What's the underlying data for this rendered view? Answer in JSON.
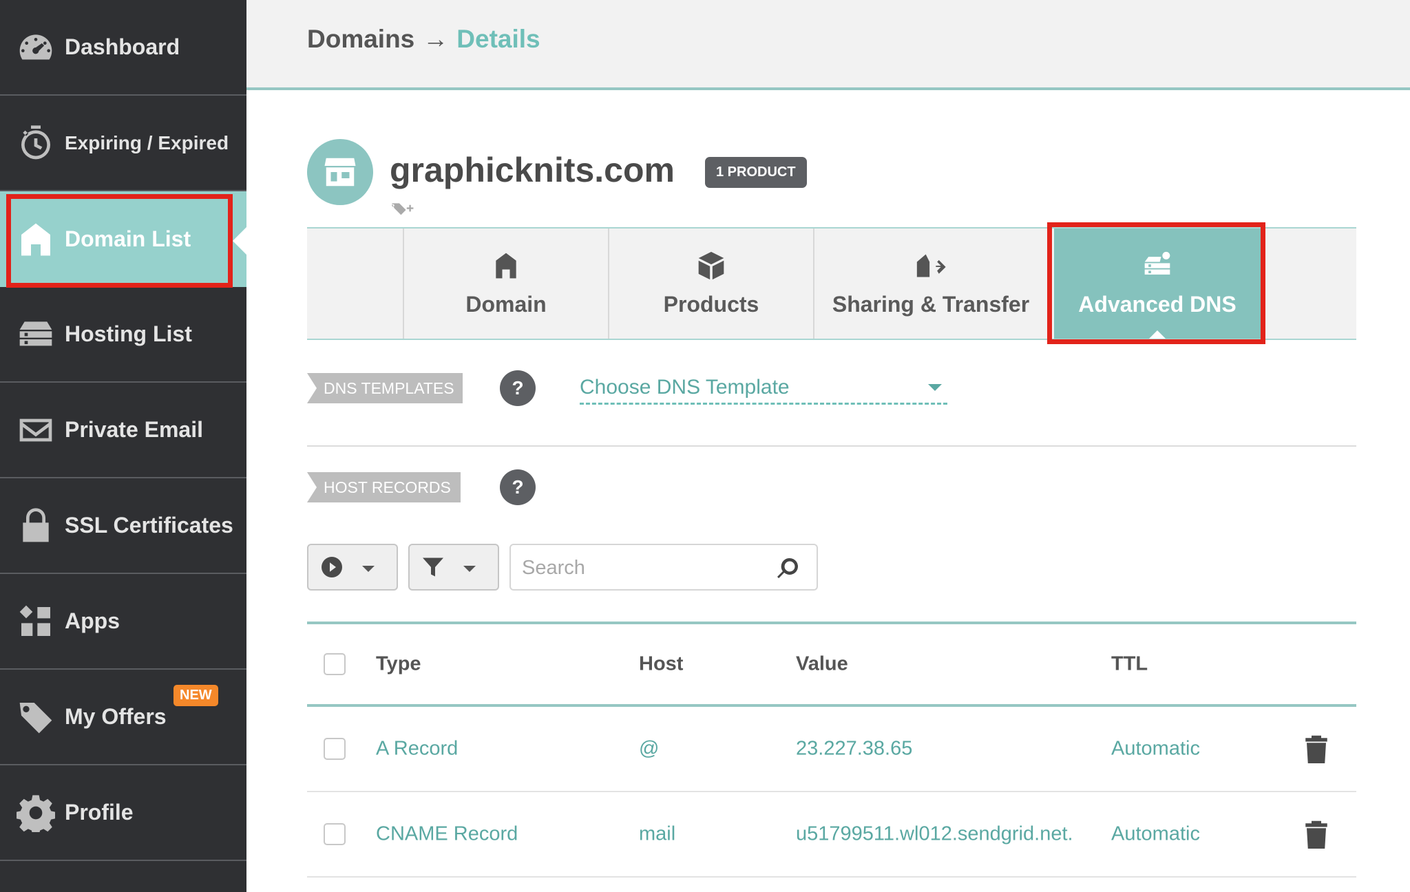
{
  "sidebar": {
    "items": [
      {
        "label": "Dashboard",
        "icon": "speedometer-icon"
      },
      {
        "label": "Expiring / Expired",
        "icon": "timer-icon"
      },
      {
        "label": "Domain List",
        "icon": "home-icon"
      },
      {
        "label": "Hosting List",
        "icon": "server-icon"
      },
      {
        "label": "Private Email",
        "icon": "envelope-icon"
      },
      {
        "label": "SSL Certificates",
        "icon": "lock-icon"
      },
      {
        "label": "Apps",
        "icon": "apps-grid-icon"
      },
      {
        "label": "My Offers",
        "icon": "tag-icon",
        "badge": "NEW"
      },
      {
        "label": "Profile",
        "icon": "gear-icon"
      }
    ],
    "active_index": 2,
    "highlight_color": "#e2231a"
  },
  "header": {
    "breadcrumb_root": "Domains",
    "breadcrumb_arrow": "→",
    "breadcrumb_current": "Details"
  },
  "domain": {
    "name": "graphicknits.com",
    "product_badge": "1 PRODUCT",
    "avatar_icon": "storefront-icon"
  },
  "tabs": [
    {
      "label": "Domain",
      "icon": "home-icon"
    },
    {
      "label": "Products",
      "icon": "box-icon"
    },
    {
      "label": "Sharing & Transfer",
      "icon": "share-transfer-icon"
    },
    {
      "label": "Advanced DNS",
      "icon": "dns-server-icon"
    }
  ],
  "active_tab": "Advanced DNS",
  "dns_templates": {
    "label": "DNS TEMPLATES",
    "help": "?",
    "select_value": "Choose DNS Template"
  },
  "host_records": {
    "label": "HOST RECORDS",
    "help": "?",
    "search_placeholder": "Search",
    "columns": {
      "type": "Type",
      "host": "Host",
      "value": "Value",
      "ttl": "TTL"
    },
    "rows": [
      {
        "type": "A Record",
        "host": "@",
        "value": "23.227.38.65",
        "ttl": "Automatic"
      },
      {
        "type": "CNAME Record",
        "host": "mail",
        "value": "u51799511.wl012.sendgrid.net.",
        "ttl": "Automatic"
      }
    ]
  },
  "colors": {
    "sidebar_bg": "#2f3033",
    "accent": "#96d1cc",
    "link": "#5aa8a2",
    "highlight": "#e2231a"
  }
}
